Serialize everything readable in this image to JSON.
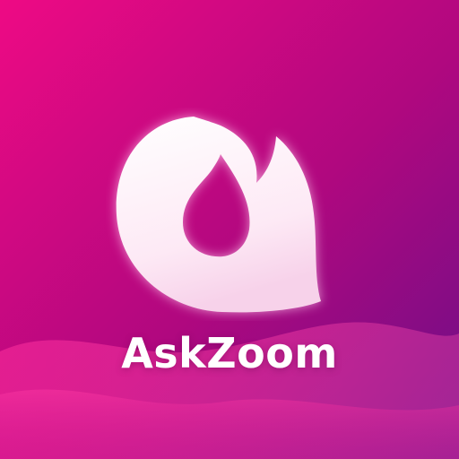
{
  "app": {
    "name": "AskZoom"
  },
  "logo": {
    "icon": "flame-icon"
  },
  "colors": {
    "background_top_left": "#ee0a84",
    "background_bottom_right": "#6c0f86",
    "wave_color": "#ff3fa6",
    "logo_fill": "#ffffff",
    "text": "#ffffff"
  }
}
